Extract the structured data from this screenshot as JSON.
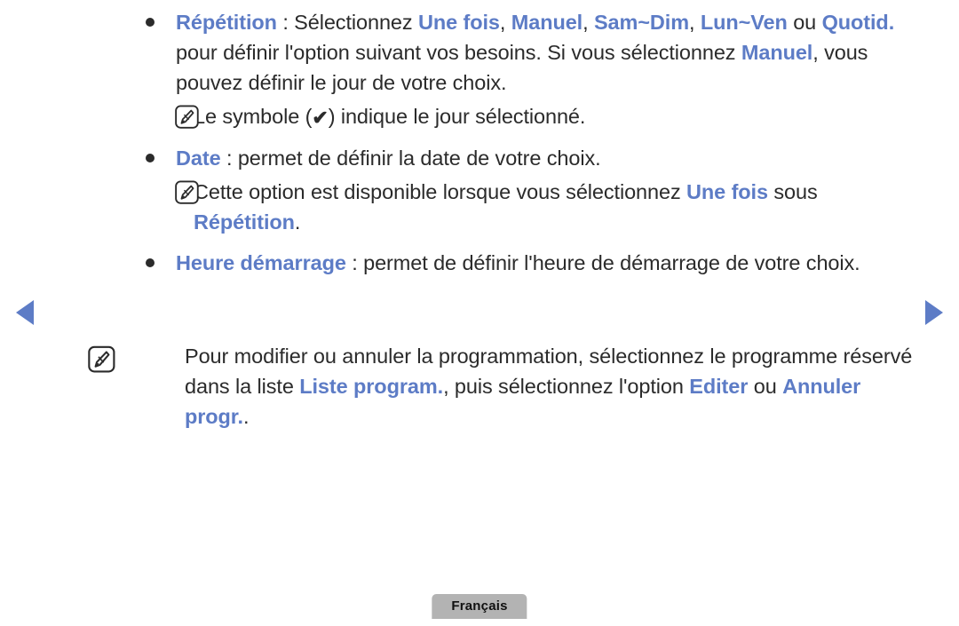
{
  "page": {
    "language_badge": "Français",
    "accent_color": "#5d7cc6",
    "text_color": "#2b2b2b",
    "badge_color": "#b3b3b3"
  },
  "nav": {
    "prev_icon": "triangle-left-icon",
    "prev_label": "◀",
    "next_icon": "triangle-right-icon",
    "next_label": "▶"
  },
  "bullets": [
    {
      "icon": "bullet-dot-icon",
      "segments": [
        {
          "text": "Répétition",
          "style": "kw"
        },
        {
          "text": " : Sélectionnez ",
          "style": "plain"
        },
        {
          "text": "Une fois",
          "style": "kw"
        },
        {
          "text": ", ",
          "style": "plain"
        },
        {
          "text": "Manuel",
          "style": "kw"
        },
        {
          "text": ", ",
          "style": "plain"
        },
        {
          "text": "Sam~Dim",
          "style": "kw"
        },
        {
          "text": ", ",
          "style": "plain"
        },
        {
          "text": "Lun~Ven",
          "style": "kw"
        },
        {
          "text": " ou ",
          "style": "plain"
        },
        {
          "text": "Quotid.",
          "style": "kw"
        },
        {
          "text": " pour définir l'option suivant vos besoins. Si vous sélectionnez ",
          "style": "plain"
        },
        {
          "text": "Manuel",
          "style": "kw"
        },
        {
          "text": ", vous pouvez définir le jour de votre choix.",
          "style": "plain"
        }
      ]
    },
    {
      "icon": "bullet-dot-icon",
      "segments": [
        {
          "text": "Date",
          "style": "kw"
        },
        {
          "text": " : permet de définir la date de votre choix.",
          "style": "plain"
        }
      ]
    },
    {
      "icon": "bullet-dot-icon",
      "segments": [
        {
          "text": "Heure démarrage",
          "style": "kw"
        },
        {
          "text": " : permet de définir l'heure de démarrage de votre choix.",
          "style": "plain"
        }
      ]
    }
  ],
  "notes": {
    "note_check": {
      "icon": "note-pen-icon",
      "prefix": "Le symbole (",
      "check_symbol": "✔",
      "suffix": ") indique le jour sélectionné."
    },
    "note_date": {
      "icon": "note-pen-icon",
      "segments": [
        {
          "text": "Cette option est disponible lorsque vous sélectionnez ",
          "style": "plain"
        },
        {
          "text": "Une fois",
          "style": "kw"
        },
        {
          "text": " sous ",
          "style": "plain"
        },
        {
          "text": "Répétition",
          "style": "kw"
        },
        {
          "text": ".",
          "style": "plain"
        }
      ]
    },
    "note_outer": {
      "icon": "note-pen-icon",
      "segments": [
        {
          "text": "Pour modifier ou annuler la programmation, sélectionnez le programme réservé dans la liste ",
          "style": "plain"
        },
        {
          "text": "Liste program.",
          "style": "kw"
        },
        {
          "text": ", puis sélectionnez l'option ",
          "style": "plain"
        },
        {
          "text": "Editer",
          "style": "kw"
        },
        {
          "text": " ou ",
          "style": "plain"
        },
        {
          "text": "Annuler progr.",
          "style": "kw"
        },
        {
          "text": ".",
          "style": "plain"
        }
      ]
    }
  }
}
